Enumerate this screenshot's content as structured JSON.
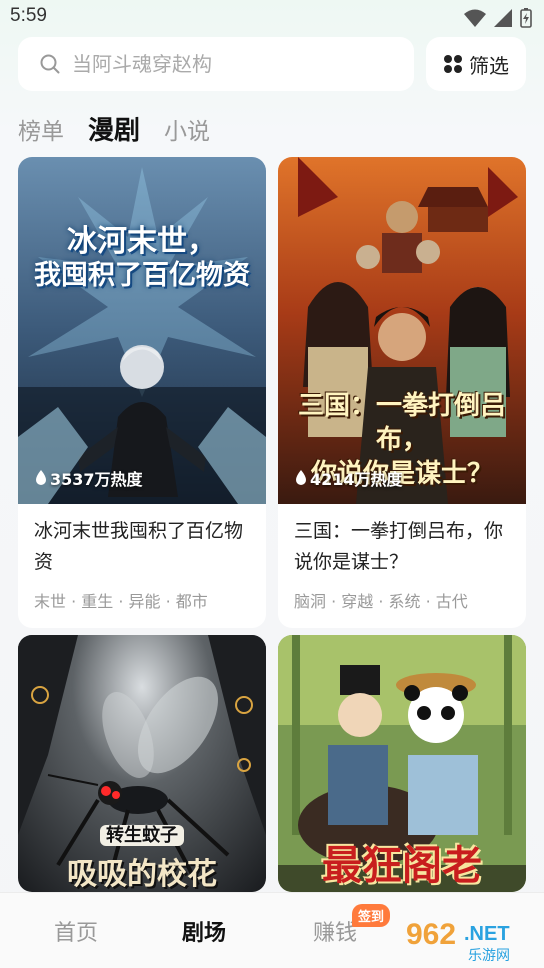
{
  "status_bar": {
    "time": "5:59"
  },
  "search": {
    "placeholder": "当阿斗魂穿赵构"
  },
  "filter": {
    "label": "筛选"
  },
  "tabs": [
    {
      "label": "榜单",
      "active": false
    },
    {
      "label": "漫剧",
      "active": true
    },
    {
      "label": "小说",
      "active": false
    }
  ],
  "cards": [
    {
      "cover_text_line1": "冰河末世，",
      "cover_text_line2": "我囤积了百亿物资",
      "heat": "3537万热度",
      "title": "冰河末世我囤积了百亿物资",
      "tags": "末世 · 重生 · 异能 · 都市"
    },
    {
      "cover_text_line1": "三国：一拳打倒吕布，",
      "cover_text_line2": "你说你是谋士？",
      "heat": "4214万热度",
      "title": "三国：一拳打倒吕布，你说你是谋士？",
      "tags": "脑洞 · 穿越 · 系统 · 古代"
    },
    {
      "cover_text_line1": "转生蚊子",
      "cover_text_line2": "吸吸的校花"
    },
    {
      "cover_text_line1": "最狂阁老"
    }
  ],
  "bottom_nav": [
    {
      "label": "首页",
      "active": false
    },
    {
      "label": "剧场",
      "active": true
    },
    {
      "label": "赚钱",
      "active": false,
      "badge": "签到"
    }
  ],
  "watermark": {
    "text": "962",
    "suffix": ".NET",
    "sub": "乐游网"
  }
}
